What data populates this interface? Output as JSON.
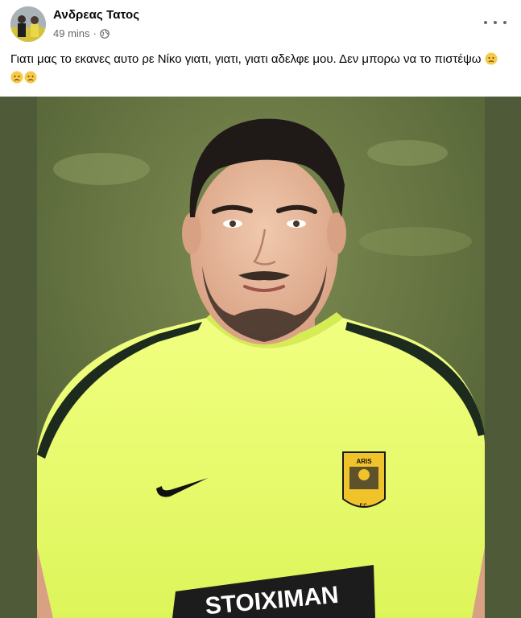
{
  "post": {
    "author": "Ανδρεας Τατος",
    "time": "49 mins",
    "separator": "·",
    "text": "Γιατι μας το εκανες αυτο ρε Νίκο γιατι, γιατι, γιατι αδελφε μου. Δεν μπορω να το πιστέψω"
  },
  "photo": {
    "badge_top": "ARIS",
    "badge_bottom": "F.C.",
    "sponsor": "STOIXIMAN"
  },
  "colors": {
    "jersey": "#eaff6e",
    "background_green": "#4e5a38",
    "text_secondary": "#65676b"
  },
  "icons": [
    "globe-icon",
    "more-options-icon",
    "sad-emoji-icon",
    "nike-swoosh-icon",
    "club-crest-icon"
  ]
}
